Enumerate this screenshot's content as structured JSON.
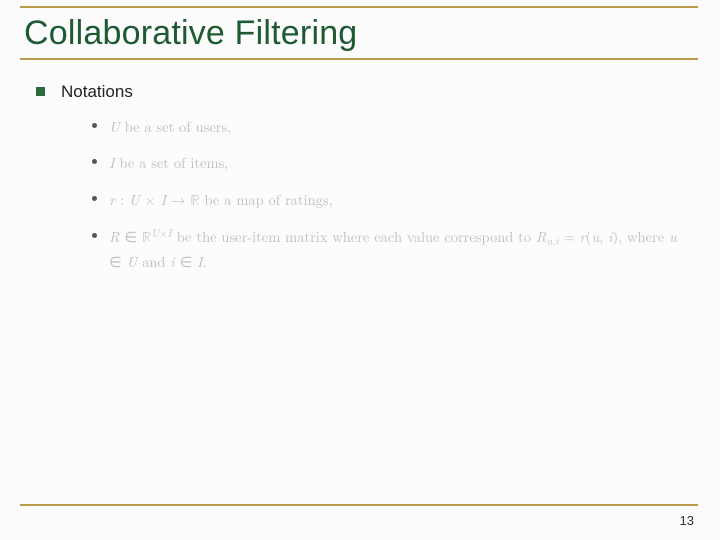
{
  "title": "Collaborative Filtering",
  "section": "Notations",
  "items": [
    "<i>U</i> be a set of users,",
    "<i>I</i> be a set of items,",
    "<i>r</i> : <i>U</i> × <i>I</i> → <span class=\"bb\">ℝ</span> be a map of ratings,",
    "<i>R</i> ∈ <span class=\"bb\">ℝ</span><span class=\"sup\"><i>U</i>×<i>I</i></span> be the user-item matrix where each value correspond to <i>R</i><span class=\"sub\"><i>u</i>,<i>i</i></span> = <i>r</i>(<i>u</i>, <i>i</i>), where <i>u</i> ∈ <i>U</i> and <i>i</i> ∈ <i>I</i>."
  ],
  "page_number": "13"
}
